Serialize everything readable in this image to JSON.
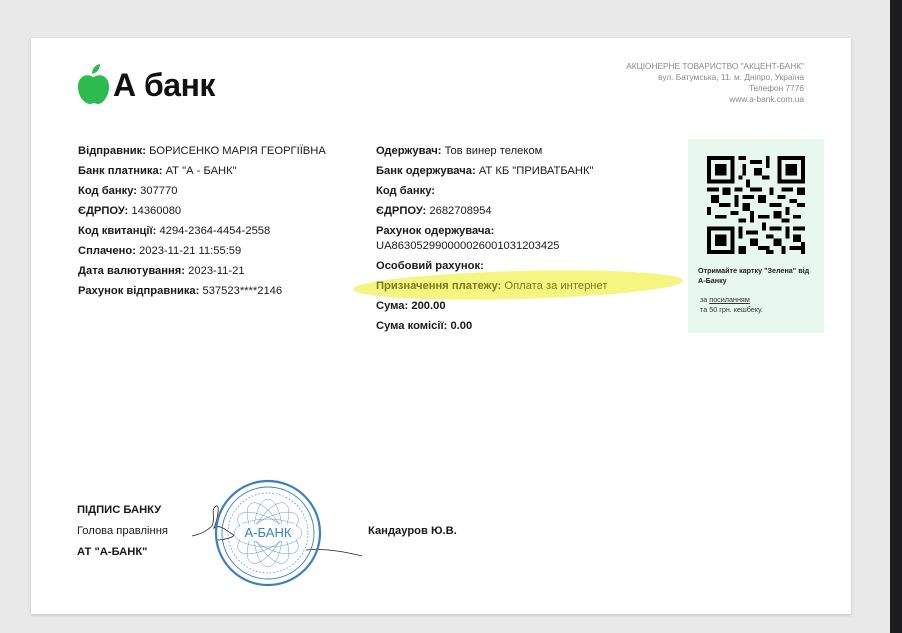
{
  "brand": {
    "name": "А банк",
    "color": "#2dba4e"
  },
  "bank_info": {
    "company": "АКЦІОНЕРНЕ ТОВАРИСТВО \"АКЦЕНТ-БАНК\"",
    "address": "вул. Батумська, 11. м. Дніпро, Україна",
    "phone": "Телефон 7776",
    "website": "www.a-bank.com.ua"
  },
  "sender": {
    "name_label": "Відправник:",
    "name_value": "БОРИСЕНКО МАРІЯ ГЕОРГІЇВНА",
    "bank_label": "Банк платника:",
    "bank_value": "АТ \"А - БАНК\"",
    "code_label": "Код банку:",
    "code_value": "307770",
    "edrpou_label": "ЄДРПОУ:",
    "edrpou_value": "14360080",
    "receipt_label": "Код квитанції:",
    "receipt_value": "4294-2364-4454-2558",
    "paid_label": "Сплачено:",
    "paid_value": "2023-11-21 11:55:59",
    "value_date_label": "Дата валютування:",
    "value_date_value": "2023-11-21",
    "account_label": "Рахунок відправника:",
    "account_value": "537523****2146"
  },
  "receiver": {
    "name_label": "Одержувач:",
    "name_value": "Тов винер телеком",
    "bank_label": "Банк одержувача:",
    "bank_value": "АТ КБ \"ПРИВАТБАНК\"",
    "code_label": "Код банку:",
    "code_value": "",
    "edrpou_label": "ЄДРПОУ:",
    "edrpou_value": "2682708954",
    "account_label": "Рахунок одержувача:",
    "account_value": "UA863052990000026001031203425",
    "personal_label": "Особовий рахунок:",
    "personal_value": "",
    "purpose_label": "Призначення платежу:",
    "purpose_value": "Оплата за интернет",
    "sum_label": "Сума:",
    "sum_value": "200.00",
    "fee_label": "Сума комісії:",
    "fee_value": "0.00"
  },
  "promo": {
    "title": "Отримайте картку \"Зелена\" від А-Банку",
    "sub_prefix": "за",
    "sub_link": "посиланням",
    "sub_suffix": "та 50 грн. кешбеку.",
    "background": "#e8f8ee"
  },
  "signature": {
    "title": "ПІДПИС БАНКУ",
    "position": "Голова правління",
    "org": "АТ \"А-БАНК\"",
    "signatory": "Кандауров Ю.В."
  },
  "stamp": {
    "center_text": "А-БАНК",
    "color": "#3a7fc0"
  },
  "highlight_color": "#f4f574"
}
